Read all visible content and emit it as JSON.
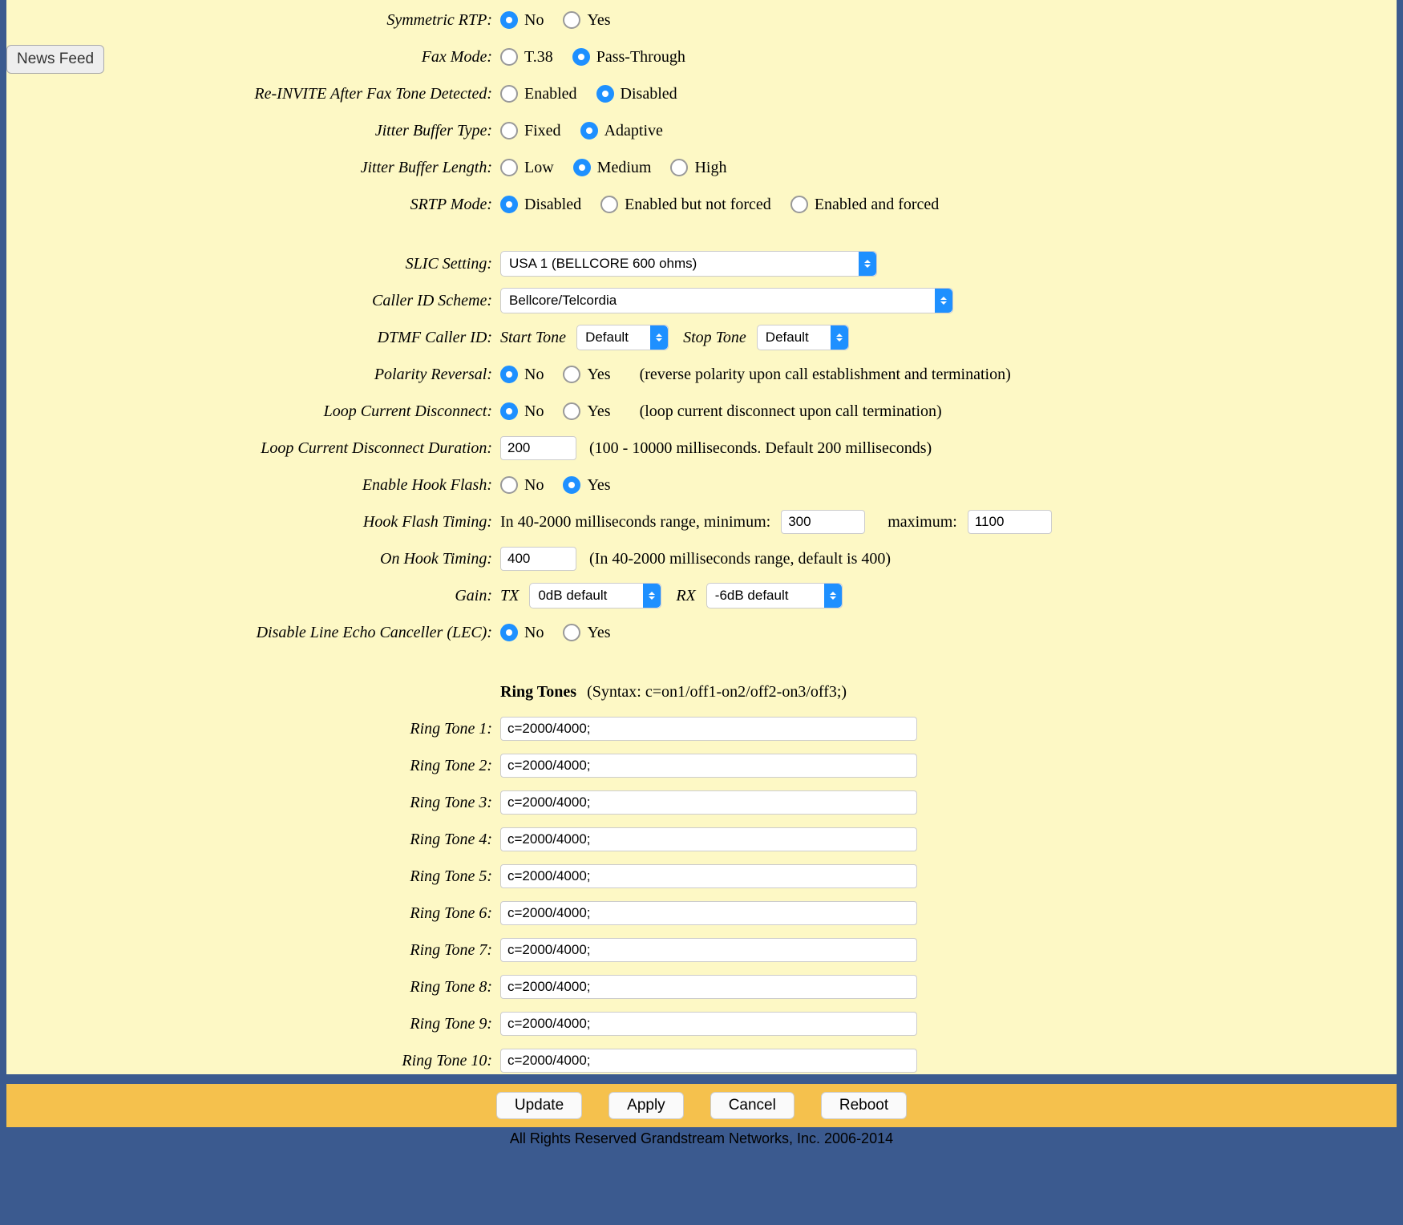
{
  "news_feed": "News Feed",
  "rows": {
    "symmetric_rtp": {
      "label": "Symmetric RTP:",
      "opts": [
        "No",
        "Yes"
      ],
      "sel": 0
    },
    "fax_mode": {
      "label": "Fax Mode:",
      "opts": [
        "T.38",
        "Pass-Through"
      ],
      "sel": 1
    },
    "reinvite": {
      "label": "Re-INVITE After Fax Tone Detected:",
      "opts": [
        "Enabled",
        "Disabled"
      ],
      "sel": 1
    },
    "jitter_type": {
      "label": "Jitter Buffer Type:",
      "opts": [
        "Fixed",
        "Adaptive"
      ],
      "sel": 1
    },
    "jitter_len": {
      "label": "Jitter Buffer Length:",
      "opts": [
        "Low",
        "Medium",
        "High"
      ],
      "sel": 1
    },
    "srtp": {
      "label": "SRTP Mode:",
      "opts": [
        "Disabled",
        "Enabled but not forced",
        "Enabled and forced"
      ],
      "sel": 0
    },
    "slic": {
      "label": "SLIC Setting:",
      "value": "USA 1 (BELLCORE 600 ohms)"
    },
    "cid_scheme": {
      "label": "Caller ID Scheme:",
      "value": "Bellcore/Telcordia"
    },
    "dtmf_cid": {
      "label": "DTMF Caller ID:",
      "start_lbl": "Start Tone",
      "start_val": "Default",
      "stop_lbl": "Stop Tone",
      "stop_val": "Default"
    },
    "polarity": {
      "label": "Polarity Reversal:",
      "opts": [
        "No",
        "Yes"
      ],
      "sel": 0,
      "hint": "(reverse polarity upon call establishment and termination)"
    },
    "loop_disc": {
      "label": "Loop Current Disconnect:",
      "opts": [
        "No",
        "Yes"
      ],
      "sel": 0,
      "hint": "(loop current disconnect upon call termination)"
    },
    "loop_dur": {
      "label": "Loop Current Disconnect Duration:",
      "value": "200",
      "hint": "(100 - 10000 milliseconds. Default 200 milliseconds)"
    },
    "hook_flash": {
      "label": "Enable Hook Flash:",
      "opts": [
        "No",
        "Yes"
      ],
      "sel": 1
    },
    "hook_timing": {
      "label": "Hook Flash Timing:",
      "pre": "In 40-2000 milliseconds range, minimum:",
      "min": "300",
      "max_lbl": "maximum:",
      "max": "1100"
    },
    "on_hook": {
      "label": "On Hook Timing:",
      "value": "400",
      "hint": "(In 40-2000 milliseconds range, default is 400)"
    },
    "gain": {
      "label": "Gain:",
      "tx_lbl": "TX",
      "tx_val": "0dB default",
      "rx_lbl": "RX",
      "rx_val": "-6dB default"
    },
    "lec": {
      "label": "Disable Line Echo Canceller (LEC):",
      "opts": [
        "No",
        "Yes"
      ],
      "sel": 0
    }
  },
  "ring_tones": {
    "title": "Ring Tones",
    "syntax": "(Syntax: c=on1/off1-on2/off2-on3/off3;)",
    "items": [
      {
        "label": "Ring Tone 1:",
        "value": "c=2000/4000;"
      },
      {
        "label": "Ring Tone 2:",
        "value": "c=2000/4000;"
      },
      {
        "label": "Ring Tone 3:",
        "value": "c=2000/4000;"
      },
      {
        "label": "Ring Tone 4:",
        "value": "c=2000/4000;"
      },
      {
        "label": "Ring Tone 5:",
        "value": "c=2000/4000;"
      },
      {
        "label": "Ring Tone 6:",
        "value": "c=2000/4000;"
      },
      {
        "label": "Ring Tone 7:",
        "value": "c=2000/4000;"
      },
      {
        "label": "Ring Tone 8:",
        "value": "c=2000/4000;"
      },
      {
        "label": "Ring Tone 9:",
        "value": "c=2000/4000;"
      },
      {
        "label": "Ring Tone 10:",
        "value": "c=2000/4000;"
      }
    ]
  },
  "buttons": {
    "update": "Update",
    "apply": "Apply",
    "cancel": "Cancel",
    "reboot": "Reboot"
  },
  "footer": "All Rights Reserved Grandstream Networks, Inc. 2006-2014"
}
